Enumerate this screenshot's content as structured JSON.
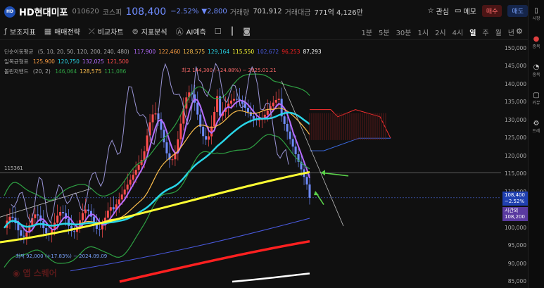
{
  "header": {
    "logo_text": "HD",
    "name": "HD현대미포",
    "code": "010620",
    "market": "코스피",
    "price": "108,400",
    "change_pct": "−2.52%",
    "change_abs": "▼2,800",
    "volume_label": "거래량",
    "volume": "701,912",
    "amount_label": "거래대금",
    "amount": "771억 4,126만",
    "watch_label": "관심",
    "memo_label": "메모",
    "buy_label": "매수",
    "sell_label": "매도"
  },
  "toolbar": {
    "indicator_label": "보조지표",
    "strategy_label": "매매전략",
    "compare_label": "비교차트",
    "analysis_label": "지표분석",
    "ai_label": "AI예측",
    "periods": [
      "1분",
      "5분",
      "30분",
      "1시",
      "2시",
      "4시",
      "일",
      "주",
      "월",
      "년"
    ],
    "active_period": "일"
  },
  "sidebar": {
    "items": [
      "시장",
      "종목",
      "종목",
      "커뮤",
      "트레"
    ]
  },
  "legend": {
    "ma_label": "단순이동평균",
    "ma_params": "(5, 10, 20, 50, 120, 200, 240, 480)",
    "ma_values": [
      "117,900",
      "122,460",
      "128,575",
      "129,164",
      "115,550",
      "102,672",
      "96,253",
      "87,293"
    ],
    "ichimoku_label": "일목균형표",
    "ichimoku_values": [
      "125,900",
      "120,750",
      "132,025",
      "121,500"
    ],
    "bollinger_label": "볼린저밴드",
    "bollinger_params": "(20, 2)",
    "bollinger_values": [
      "146,064",
      "128,575",
      "111,086"
    ]
  },
  "colors": {
    "up": "#ff4d4d",
    "down": "#6f8cff",
    "ma5": "#b56cff",
    "ma10": "#ff9f43",
    "ma20": "#ffc04d",
    "ma50": "#29d6e8",
    "ma120": "#ffff33",
    "ma200": "#4a5ae0",
    "ma240": "#ff2020",
    "ma480": "#ffffff",
    "bollinger": "#2ea043"
  },
  "chart_data": {
    "type": "candlestick",
    "y_ticks": [
      "150,000",
      "145,000",
      "140,000",
      "135,000",
      "130,000",
      "125,000",
      "120,000",
      "115,000",
      "110,000",
      "105,000",
      "100,000",
      "95,000",
      "90,000",
      "85,000"
    ],
    "ylim": [
      85000,
      150000
    ],
    "high_annotation": "최고 144,300 (−24.88%) − 2025.01.21",
    "low_annotation": "최저 92,000 (+17.83%) − 2024.09.09",
    "level_line": "115361",
    "current_price_tag": [
      "108,400",
      "−2.52%"
    ],
    "time_tag": [
      "시간외",
      "108,200"
    ],
    "series": [
      {
        "name": "5",
        "last": 117900
      },
      {
        "name": "10",
        "last": 122460
      },
      {
        "name": "20",
        "last": 128575
      },
      {
        "name": "50",
        "last": 129164
      },
      {
        "name": "120",
        "last": 115550
      },
      {
        "name": "200",
        "last": 102672
      },
      {
        "name": "240",
        "last": 96253
      },
      {
        "name": "480",
        "last": 87293
      }
    ]
  },
  "watermark": "앱 스퀘어"
}
